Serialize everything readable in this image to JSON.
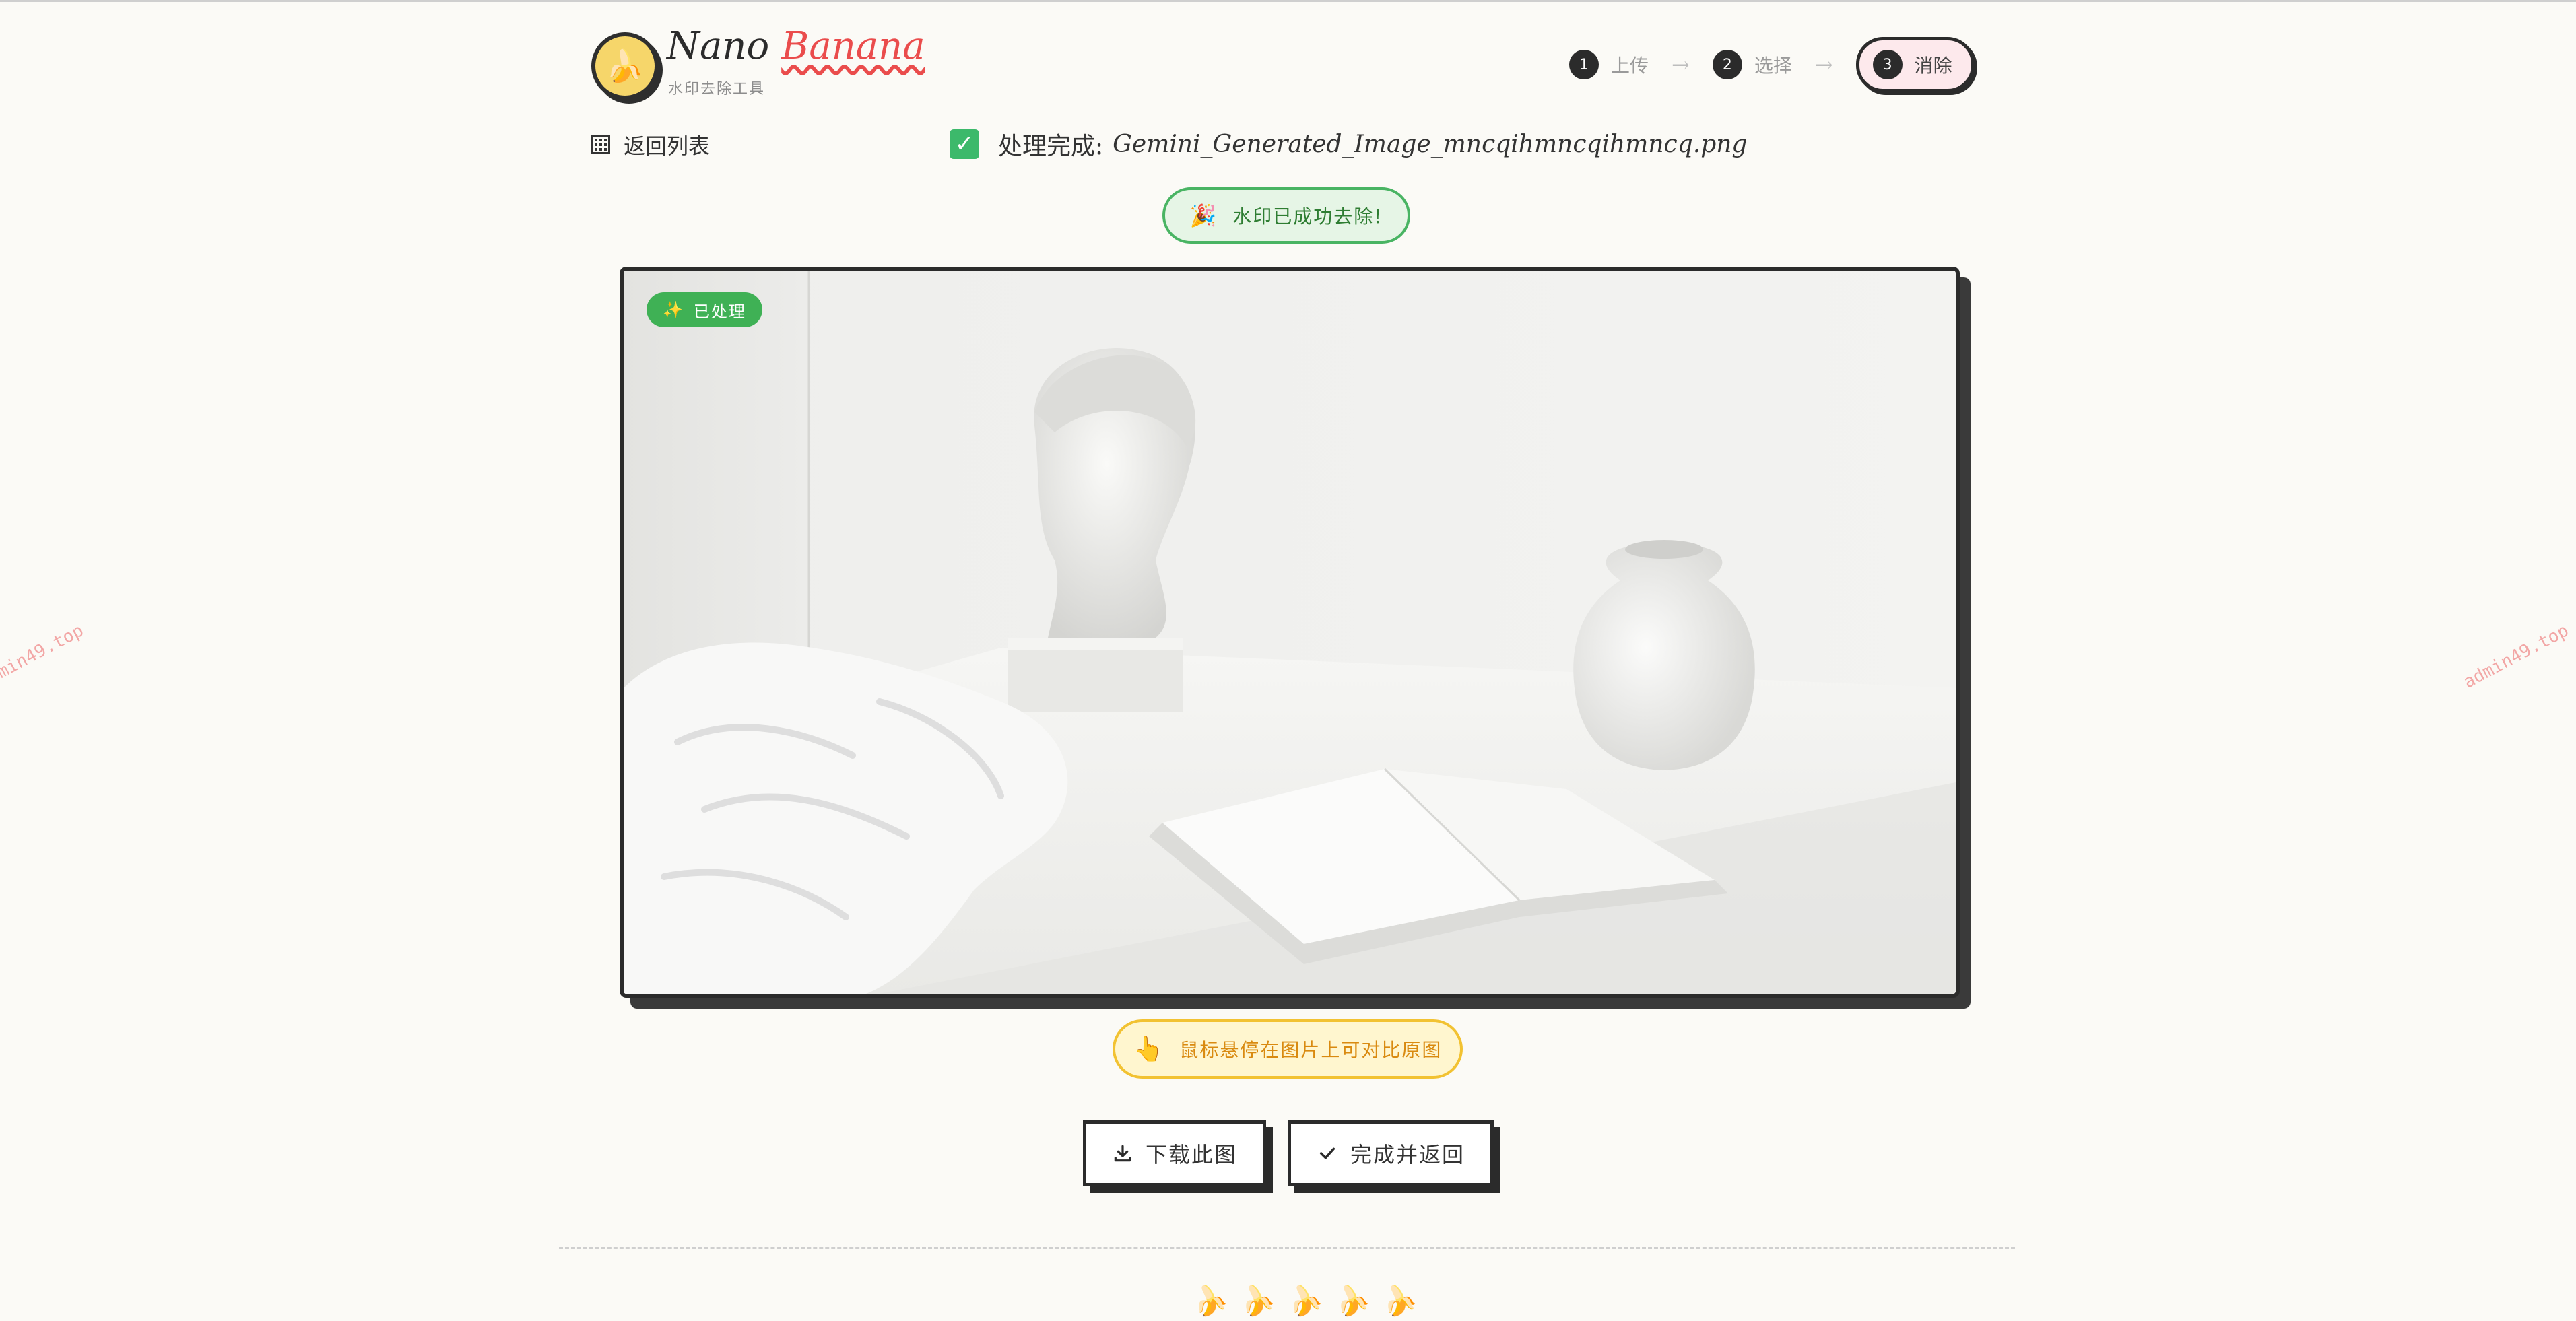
{
  "header": {
    "logo_icon": "banana-icon",
    "brand_primary": "Nano",
    "brand_accent": "Banana",
    "brand_subtitle": "水印去除工具",
    "steps": [
      {
        "num": "1",
        "label": "上传"
      },
      {
        "num": "2",
        "label": "选择"
      },
      {
        "num": "3",
        "label": "消除"
      }
    ],
    "step_arrow": "→"
  },
  "toolbar": {
    "back_label": "返回列表",
    "done_prefix": "处理完成:",
    "done_filename": "Gemini_Generated_Image_mncqihmncqihmncq.png"
  },
  "status": {
    "success_icon": "🎉",
    "success_text": "水印已成功去除!"
  },
  "image": {
    "badge_icon": "✨",
    "badge_text": "已处理"
  },
  "hint": {
    "icon": "👆",
    "text": "鼠标悬停在图片上可对比原图"
  },
  "actions": {
    "download_label": "下载此图",
    "done_label": "完成并返回"
  },
  "watermark": "admin49.top",
  "footer": {
    "icons": [
      "🍌",
      "🍌",
      "🍌",
      "🍌",
      "🍌"
    ]
  },
  "colors": {
    "accent_red": "#ea4c4c",
    "success_green": "#3cb96b",
    "hint_yellow": "#f2c232",
    "background": "#fbfaf6"
  }
}
